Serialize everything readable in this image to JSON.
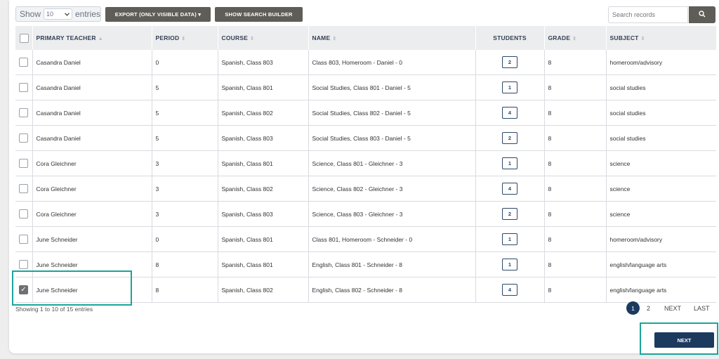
{
  "toolbar": {
    "show_label": "Show",
    "entries_value": "10",
    "entries_label": "entries",
    "export_label": "EXPORT (ONLY VISIBLE DATA) ▾",
    "search_builder_label": "SHOW SEARCH BUILDER",
    "search_placeholder": "Search records"
  },
  "table": {
    "headers": {
      "teacher": "PRIMARY TEACHER",
      "period": "PERIOD",
      "course": "COURSE",
      "name": "NAME",
      "students": "STUDENTS",
      "grade": "GRADE",
      "subject": "SUBJECT"
    },
    "rows": [
      {
        "checked": false,
        "teacher": "Casandra Daniel",
        "period": "0",
        "course": "Spanish, Class 803",
        "name": "Class 803, Homeroom - Daniel - 0",
        "students": "2",
        "grade": "8",
        "subject": "homeroom/advisory"
      },
      {
        "checked": false,
        "teacher": "Casandra Daniel",
        "period": "5",
        "course": "Spanish, Class 801",
        "name": "Social Studies, Class 801 - Daniel - 5",
        "students": "1",
        "grade": "8",
        "subject": "social studies"
      },
      {
        "checked": false,
        "teacher": "Casandra Daniel",
        "period": "5",
        "course": "Spanish, Class 802",
        "name": "Social Studies, Class 802 - Daniel - 5",
        "students": "4",
        "grade": "8",
        "subject": "social studies"
      },
      {
        "checked": false,
        "teacher": "Casandra Daniel",
        "period": "5",
        "course": "Spanish, Class 803",
        "name": "Social Studies, Class 803 - Daniel - 5",
        "students": "2",
        "grade": "8",
        "subject": "social studies"
      },
      {
        "checked": false,
        "teacher": "Cora Gleichner",
        "period": "3",
        "course": "Spanish, Class 801",
        "name": "Science, Class 801 - Gleichner - 3",
        "students": "1",
        "grade": "8",
        "subject": "science"
      },
      {
        "checked": false,
        "teacher": "Cora Gleichner",
        "period": "3",
        "course": "Spanish, Class 802",
        "name": "Science, Class 802 - Gleichner - 3",
        "students": "4",
        "grade": "8",
        "subject": "science"
      },
      {
        "checked": false,
        "teacher": "Cora Gleichner",
        "period": "3",
        "course": "Spanish, Class 803",
        "name": "Science, Class 803 - Gleichner - 3",
        "students": "2",
        "grade": "8",
        "subject": "science"
      },
      {
        "checked": false,
        "teacher": "June Schneider",
        "period": "0",
        "course": "Spanish, Class 801",
        "name": "Class 801, Homeroom - Schneider - 0",
        "students": "1",
        "grade": "8",
        "subject": "homeroom/advisory"
      },
      {
        "checked": false,
        "teacher": "June Schneider",
        "period": "8",
        "course": "Spanish, Class 801",
        "name": "English, Class 801 - Schneider - 8",
        "students": "1",
        "grade": "8",
        "subject": "english/language arts"
      },
      {
        "checked": true,
        "teacher": "June Schneider",
        "period": "8",
        "course": "Spanish, Class 802",
        "name": "English, Class 802 - Schneider - 8",
        "students": "4",
        "grade": "8",
        "subject": "english/language arts"
      }
    ]
  },
  "footer": {
    "info": "Showing 1 to 10 of 15 entries",
    "page_1": "1",
    "page_2": "2",
    "next": "NEXT",
    "last": "LAST"
  },
  "next_button_label": "NEXT",
  "colors": {
    "accent": "#1c3a5e",
    "highlight": "#1aa59a",
    "dark_button": "#5f5d58"
  }
}
